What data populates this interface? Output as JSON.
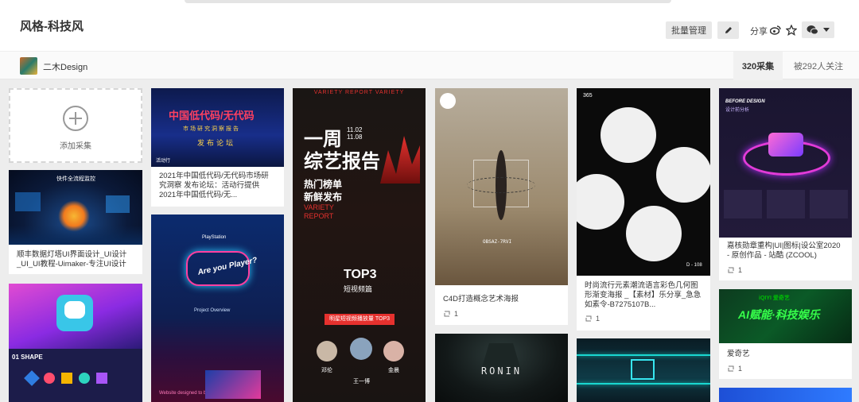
{
  "header": {
    "title": "风格-科技风",
    "batch_manage_label": "批量管理",
    "share_label": "分享"
  },
  "subheader": {
    "owner_name": "二木Design",
    "pins_count": "320采集",
    "followers_text": "被292人关注"
  },
  "add_card": {
    "label": "添加采集"
  },
  "pins": [
    {
      "caption": "顺丰数据灯塔UI界面设计_UI设计_UI_UI教程-Uimaker-专注UI设计",
      "repins": ""
    },
    {
      "caption": "2021年中国低代码/无代码市场研究洞察 发布论坛：活动行提供2021年中国低代码/无...",
      "repins": ""
    },
    {
      "caption": "",
      "repins": ""
    },
    {
      "caption": "C4D打造概念艺术海报",
      "repins": "1"
    },
    {
      "caption": "时尚流行元素潮流语言彩色几何图形渐变海报 _【素材】乐分享_急急如素令-B7275107B...",
      "repins": "1"
    },
    {
      "caption": "嘉核勋章重构|UI|图标|设公室2020 - 原创作品 - 站酷 (ZCOOL)",
      "repins": "1"
    },
    {
      "caption": "爱奇艺",
      "repins": "1"
    }
  ],
  "poster_text": {
    "lighthouse_title": "快件全流程监控",
    "lowcode_title": "中国低代码/无代码",
    "lowcode_sub": "市场研究洞察报告",
    "lowcode_forum": "发布论坛",
    "lowcode_tag": "活动行",
    "variety_top": "VARIETY  REPORT  VARIETY",
    "variety_title": "一周",
    "variety_title2": "综艺报告",
    "variety_date": "11.02\n11.08",
    "variety_hot": "热门榜单",
    "variety_new": "新鲜发布",
    "variety_eng": "VARIETY",
    "variety_report": "REPORT",
    "variety_top3": "TOP3",
    "variety_top3_sub": "短视频篇",
    "variety_bar": "明星短视频播放量 TOP3",
    "variety_names": [
      "邓伦",
      "王一博",
      "金晨"
    ],
    "c4d_code": "OBSAZ-7RVI",
    "geo_num": "365",
    "geo_tag": "D - 108",
    "badge_title": "BEFORE DESIGN",
    "badge_sub": "设计前分析",
    "ps_brand": "PlayStation",
    "ps_overview": "Project Overview",
    "ps_player": "Are you Player?",
    "ps_bottom": "Website designed to be fully responsive",
    "ronin": "RONIN",
    "iqiyi_logo": "iQIYI 爱奇艺",
    "iqiyi_title": "AI赋能·科技娱乐",
    "shape_label": "01 SHAPE"
  },
  "colors": {
    "accent_red": "#e5312e",
    "iqiyi_green": "#00be06"
  }
}
